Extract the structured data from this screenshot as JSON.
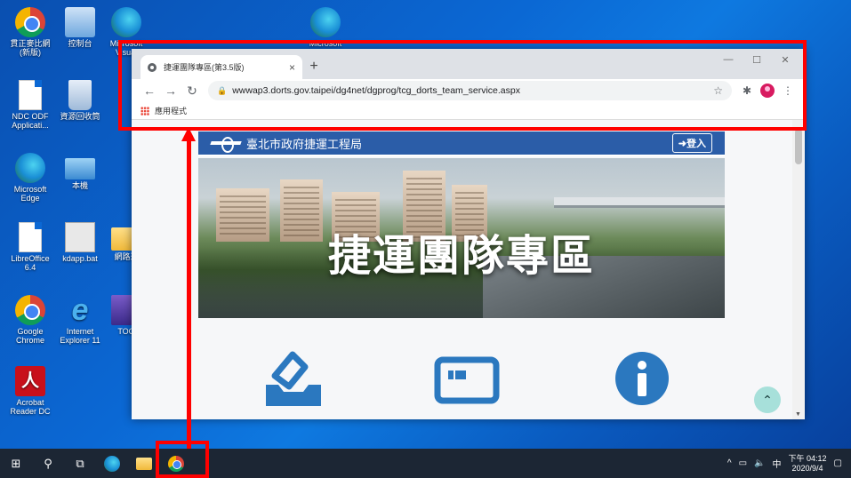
{
  "desktop": {
    "icons": [
      {
        "label": "貫正麥比網 (新版)",
        "icon": "chrome-icon"
      },
      {
        "label": "控制台",
        "icon": "control-panel-icon"
      },
      {
        "label": "Microsoft Visual",
        "icon": "edge-icon"
      },
      {
        "label": "Microsoft",
        "icon": "edge-icon"
      },
      {
        "label": "NDC ODF Applicati...",
        "icon": "document-icon"
      },
      {
        "label": "資源回收筒",
        "icon": "recycle-bin-icon"
      },
      {
        "label": "Microsoft Edge",
        "icon": "edge-icon"
      },
      {
        "label": "本機",
        "icon": "computer-icon"
      },
      {
        "label": "LibreOffice 6.4",
        "icon": "document-icon"
      },
      {
        "label": "kdapp.bat",
        "icon": "batch-file-icon"
      },
      {
        "label": "網路運",
        "icon": "folder-icon"
      },
      {
        "label": "Google Chrome",
        "icon": "chrome-icon"
      },
      {
        "label": "Internet Explorer 11",
        "icon": "ie-icon"
      },
      {
        "label": "TOO",
        "icon": "app-icon"
      },
      {
        "label": "Acrobat Reader DC",
        "icon": "pdf-icon"
      }
    ]
  },
  "browser": {
    "tab_title": "捷運團隊專區(第3.5版)",
    "tab_close": "×",
    "new_tab": "+",
    "url_host": "wwwap3.dorts.gov.taipei",
    "url_path": "/dg4net/dgprog/tcg_dorts_team_service.aspx",
    "bookmarks_label": "應用程式",
    "win_minimize": "—",
    "win_maximize": "☐",
    "win_close": "✕"
  },
  "site": {
    "org_name": "臺北市政府捷運工程局",
    "login_label": "登入",
    "hero_title": "捷運團隊專區",
    "feature_icons": [
      "vote-box-icon",
      "card-icon",
      "info-icon"
    ]
  },
  "taskbar": {
    "time": "下午 04:12",
    "date": "2020/9/4",
    "ime": "中"
  },
  "colors": {
    "annotation": "#ff0000",
    "header_blue": "#2b5da8",
    "feature_blue": "#2b78bf"
  }
}
